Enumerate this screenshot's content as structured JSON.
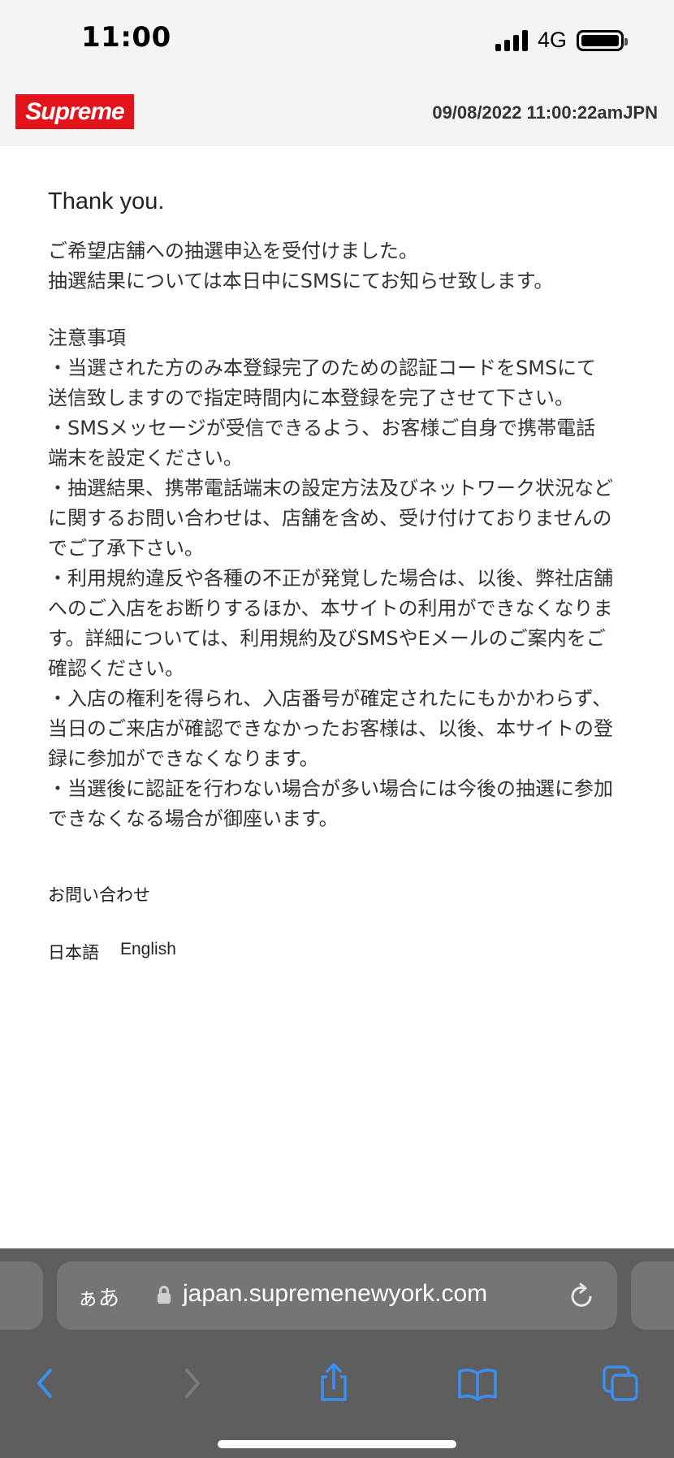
{
  "status_bar": {
    "time": "11:00",
    "network": "4G",
    "battery_level": 1.0
  },
  "header": {
    "logo_text": "Supreme",
    "datetime": "09/08/2022 11:00:22amJPN",
    "brand_color": "#e3131b"
  },
  "main": {
    "thanks": "Thank you.",
    "intro": [
      "ご希望店舗への抽選申込を受付けました。",
      "抽選結果については本日中にSMSにてお知らせ致します。"
    ],
    "notes_title": "注意事項",
    "notes": [
      [
        "・当選された方のみ本登録完了のための認証コードをSMSにて",
        "送信致しますので指定時間内に本登録を完了させて下さい。"
      ],
      [
        "・SMSメッセージが受信できるよう、お客様ご自身で携帯電話",
        "端末を設定ください。"
      ],
      [
        "・抽選結果、携帯電話端末の設定方法及びネットワーク状況など",
        "に関するお問い合わせは、店舗を含め、受け付けておりませんの",
        "でご了承下さい。"
      ],
      [
        "・利用規約違反や各種の不正が発覚した場合は、以後、弊社店舗",
        "へのご入店をお断りするほか、本サイトの利用ができなくなりま",
        "す。詳細については、利用規約及びSMSやEメールのご案内をご",
        "確認ください。"
      ],
      [
        "・入店の権利を得られ、入店番号が確定されたにもかかわらず、",
        "当日のご来店が確認できなかったお客様は、以後、本サイトの登",
        "録に参加ができなくなります。"
      ],
      [
        "・当選後に認証を行わない場合が多い場合には今後の抽選に参加",
        "できなくなる場合が御座います。"
      ]
    ],
    "contact": "お問い合わせ",
    "languages": {
      "japanese": "日本語",
      "english": "English"
    }
  },
  "browser": {
    "aa_label": "ぁあ",
    "url": "japan.supremenewyork.com",
    "icons": [
      "lock-icon",
      "reload-icon",
      "back-icon",
      "forward-icon",
      "share-icon",
      "bookmarks-icon",
      "tabs-icon"
    ]
  }
}
